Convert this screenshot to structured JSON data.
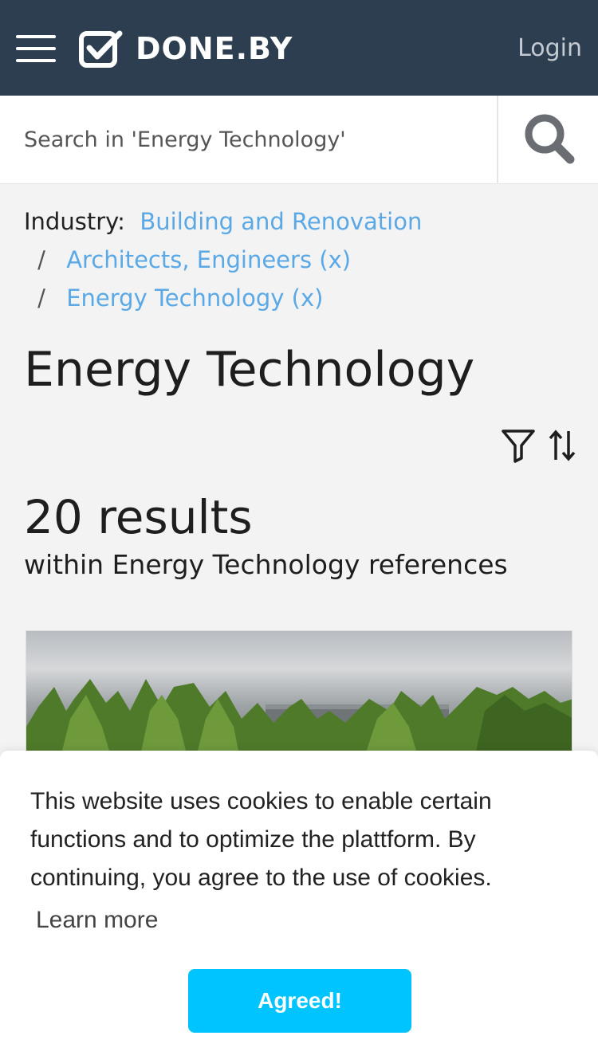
{
  "header": {
    "brand": "DONE.BY",
    "login_label": "Login",
    "menu_icon": "hamburger-menu-icon",
    "logo_icon": "checkbox-check-icon",
    "background_color": "#2c3e50"
  },
  "search": {
    "placeholder": "Search in 'Energy Technology'",
    "value": "",
    "icon": "search-icon"
  },
  "breadcrumb": {
    "label": "Industry:",
    "separator": "/",
    "items": [
      "Building and Renovation",
      "Architects, Engineers (x)",
      "Energy Technology (x)"
    ],
    "link_color": "#5aa9e6"
  },
  "page": {
    "title": "Energy Technology",
    "filter_icon": "filter-icon",
    "sort_icon": "sort-icon"
  },
  "results": {
    "count_text": "20 results",
    "subtitle": "within Energy Technology references"
  },
  "card": {
    "image_description": "building-behind-trees-photo"
  },
  "cookie": {
    "message": "This website uses cookies to enable certain functions and to optimize the plattform. By continuing, you agree to the use of cookies.",
    "learn_more": "Learn more",
    "agree_label": "Agreed!",
    "button_color": "#00c4ff"
  }
}
